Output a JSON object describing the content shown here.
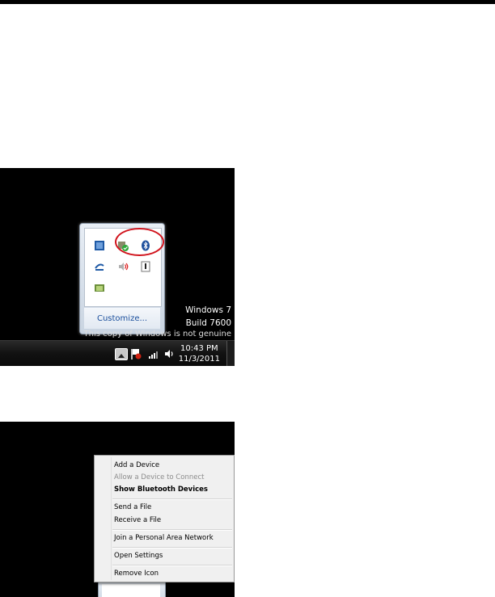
{
  "screenshot1": {
    "flyout": {
      "icons": [
        "book-icon",
        "security-shield-icon",
        "bluetooth-icon",
        "sync-icon",
        "speaker-icon",
        "usb-key-icon",
        "folder-icon"
      ],
      "customize_label": "Customize..."
    },
    "watermark": {
      "line1": "Windows 7",
      "line2": "Build 7600",
      "line3": "This copy of Windows is not genuine"
    },
    "taskbar": {
      "time": "10:43 PM",
      "date": "11/3/2011"
    },
    "highlight_color": "#d1141d"
  },
  "screenshot2": {
    "menu": {
      "add_device": "Add a Device",
      "allow_connect": "Allow a Device to Connect",
      "show_devices": "Show Bluetooth Devices",
      "send_file": "Send a File",
      "receive_file": "Receive a File",
      "join_pan": "Join a Personal Area Network",
      "open_settings": "Open Settings",
      "remove_icon": "Remove Icon"
    }
  }
}
